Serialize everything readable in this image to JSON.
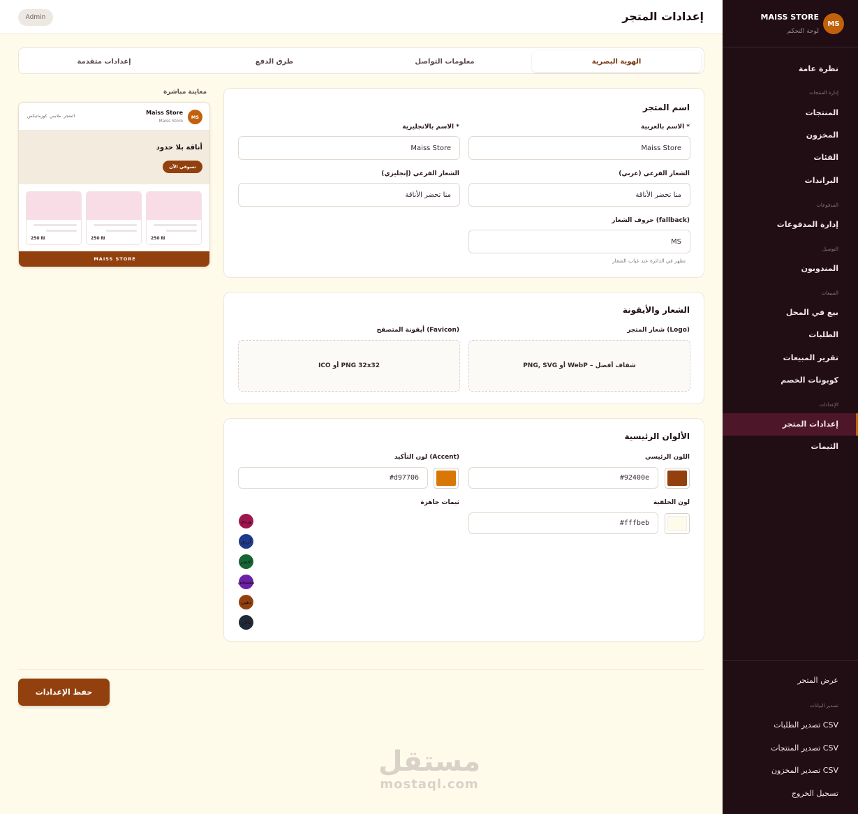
{
  "sidebar": {
    "logo_initials": "MS",
    "store_name": "MAISS STORE",
    "subtitle": "لوحة التحكم",
    "items": {
      "overview": "نظرة عامة",
      "products_section": "إدارة المنتجات",
      "products": "المنتجات",
      "inventory": "المخزون",
      "categories": "الفئات",
      "brands": "البراندات",
      "payments_section": "المدفوعات",
      "payments": "إدارة المدفوعات",
      "delivery_section": "التوصيل",
      "agents": "المندوبون",
      "sales_section": "المبيعات",
      "pos": "بيع في المحل",
      "orders": "الطلبات",
      "sales_report": "تقرير المبيعات",
      "coupons": "كوبونات الخصم",
      "settings_section": "الإعدادات",
      "store_settings": "إعدادات المتجر",
      "themes": "الثيمات",
      "view_store": "عرض المتجر",
      "export_section": "تصدير البيانات",
      "export_orders": "تصدير الطلبات CSV",
      "export_products": "تصدير المنتجات CSV",
      "export_inventory": "تصدير المخزون CSV",
      "logout": "تسجيل الخروج"
    }
  },
  "header": {
    "title": "إعدادات المتجر",
    "role_badge": "Admin"
  },
  "tabs": [
    "الهوية البصرية",
    "معلومات التواصل",
    "طرق الدفع",
    "إعدادات متقدمة"
  ],
  "store_name_card": {
    "title": "اسم المتجر",
    "name_ar_label": "الاسم بالعربية *",
    "name_ar_value": "Maiss Store",
    "name_en_label": "الاسم بالانجليزية *",
    "name_en_value": "Maiss Store",
    "tagline_ar_label": "الشعار الفرعي (عربي)",
    "tagline_ar_value": "منا تحضر الأناقة",
    "tagline_en_label": "الشعار الفرعي (إنجليزي)",
    "tagline_en_value": "منا تحضر الأناقة",
    "initials_label": "حروف الشعار (fallback)",
    "initials_value": "MS",
    "initials_hint": "تظهر في الدائرة عند غياب الشعار"
  },
  "logo_card": {
    "title": "الشعار والأيقونة",
    "logo_label": "شعار المتجر (Logo)",
    "logo_drop": "PNG, SVG أو WebP – شفاف أفضل",
    "favicon_label": "أيقونة المتصفح (Favicon)",
    "favicon_drop": "ICO أو PNG 32x32"
  },
  "colors_card": {
    "title": "الألوان الرئيسية",
    "primary_label": "اللون الرئيسي",
    "primary_value": "#92400e",
    "accent_label": "لون التأكيد (Accent)",
    "accent_value": "#d97706",
    "background_label": "لون الخلفية",
    "background_value": "#fffbeb",
    "presets_label": "ثيمات جاهزة",
    "presets": [
      {
        "name": "وردي",
        "color": "#9d174d"
      },
      {
        "name": "أزرق",
        "color": "#1e3a8a"
      },
      {
        "name": "أخضر",
        "color": "#166534"
      },
      {
        "name": "بنفسجي",
        "color": "#6b21a8"
      },
      {
        "name": "ذهبي",
        "color": "#92400e"
      },
      {
        "name": "داكن",
        "color": "#1f2937"
      }
    ]
  },
  "preview": {
    "label": "معاينة مباشرة",
    "logo_initials": "MS",
    "store_name": "Maiss Store",
    "store_sub": "Maiss Store",
    "nav": "المتجر   ملابس   كوزماتيكس",
    "hero_title": "أناقة بلا حدود",
    "hero_button": "تسوقي الآن",
    "prices": [
      "250 ₪",
      "250 ₪",
      "250 ₪"
    ],
    "footer": "MAISS STORE"
  },
  "save_button": "حفظ الإعدادات",
  "watermark": {
    "arabic": "مستقل",
    "latin": "mostaql.com"
  },
  "colors": {
    "primary": "#92400e",
    "accent": "#d97706",
    "background": "#fffbeb",
    "sidebar": "#210d14"
  }
}
